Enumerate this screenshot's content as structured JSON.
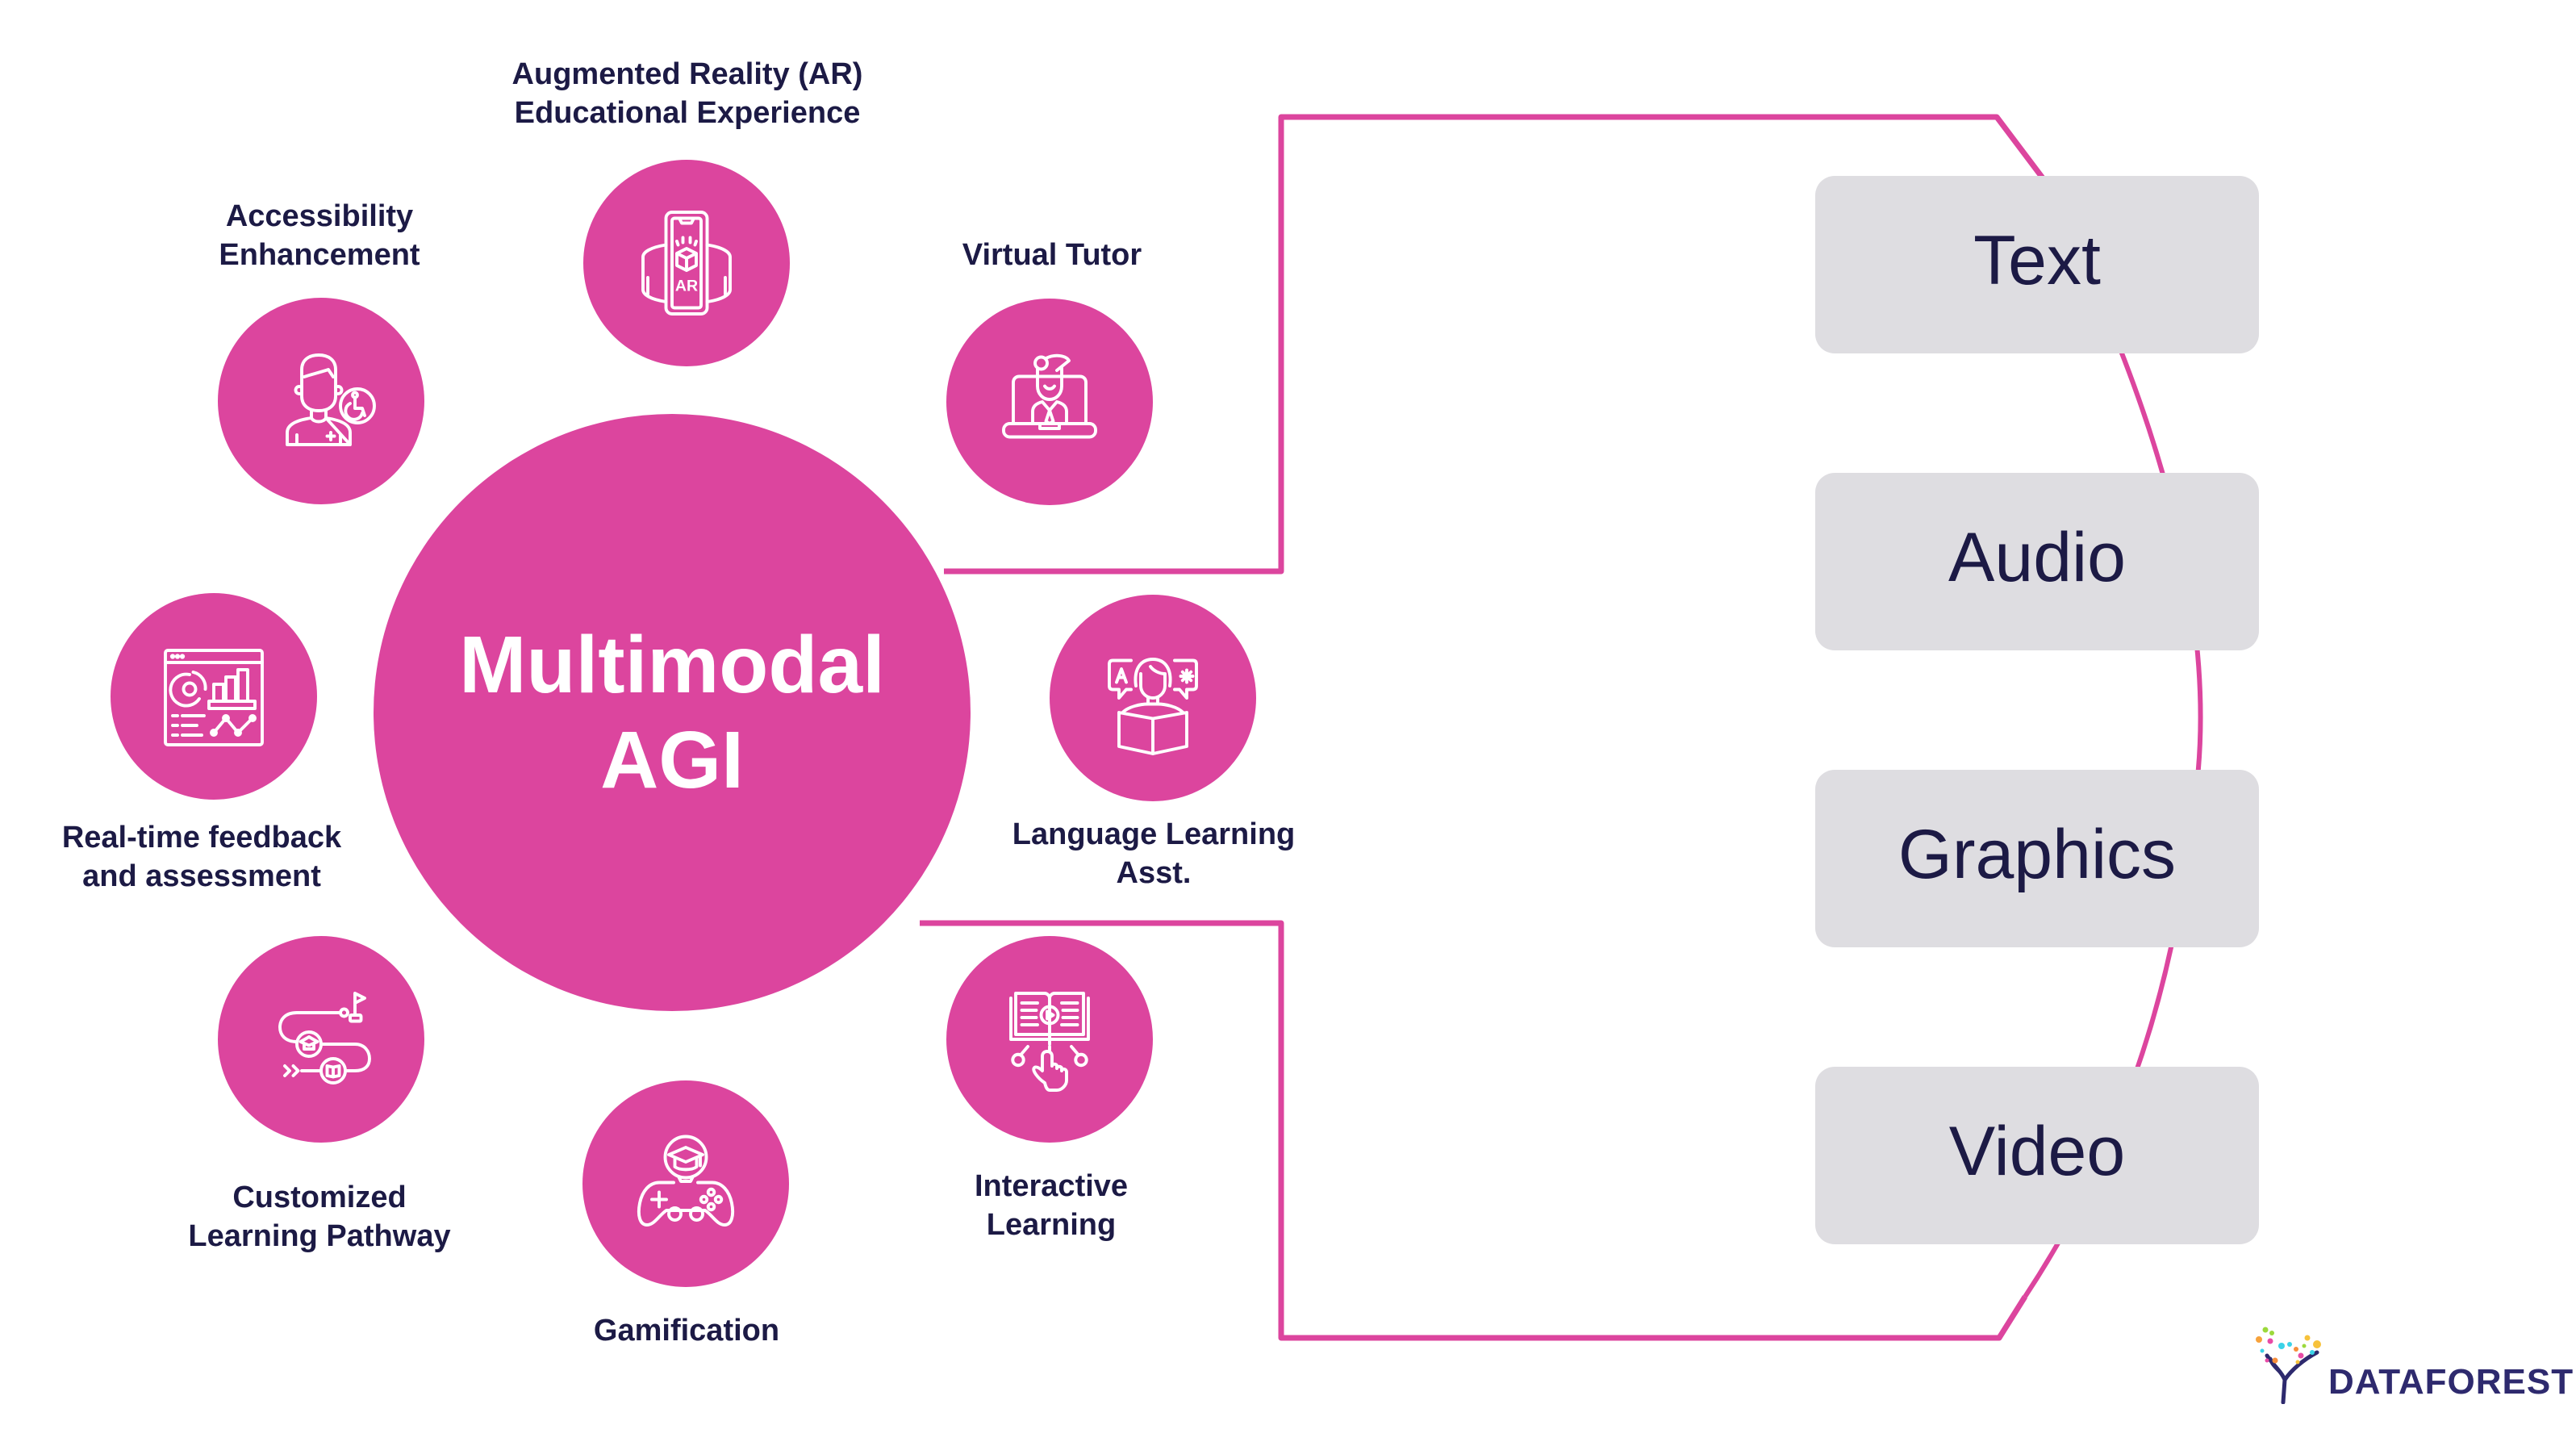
{
  "colors": {
    "accent": "#DC459E",
    "text_dark": "#1C1A45",
    "box_fill": "#DEDDE1",
    "background": "#FFFFFF",
    "logo_text": "#2E2A6E"
  },
  "hub": {
    "line1": "Multimodal",
    "line2": "AGI"
  },
  "applications": [
    {
      "id": "ar",
      "label": "Augmented Reality (AR)\nEducational Experience",
      "icon": "ar-phone-icon"
    },
    {
      "id": "virtual-tutor",
      "label": "Virtual Tutor",
      "icon": "laptop-tutor-icon"
    },
    {
      "id": "language",
      "label": "Language Learning\nAsst.",
      "icon": "reading-translation-icon"
    },
    {
      "id": "interactive",
      "label": "Interactive\nLearning",
      "icon": "book-touch-icon"
    },
    {
      "id": "gamification",
      "label": "Gamification",
      "icon": "gamepad-graduation-icon"
    },
    {
      "id": "pathway",
      "label": "Customized\nLearning Pathway",
      "icon": "learning-path-icon"
    },
    {
      "id": "feedback",
      "label": "Real-time feedback\nand assessment",
      "icon": "dashboard-analytics-icon"
    },
    {
      "id": "accessibility",
      "label": "Accessibility\nEnhancement",
      "icon": "person-wheelchair-icon"
    }
  ],
  "modalities": [
    "Text",
    "Audio",
    "Graphics",
    "Video"
  ],
  "logo": {
    "text": "DATAFOREST",
    "icon": "data-tree-icon"
  }
}
